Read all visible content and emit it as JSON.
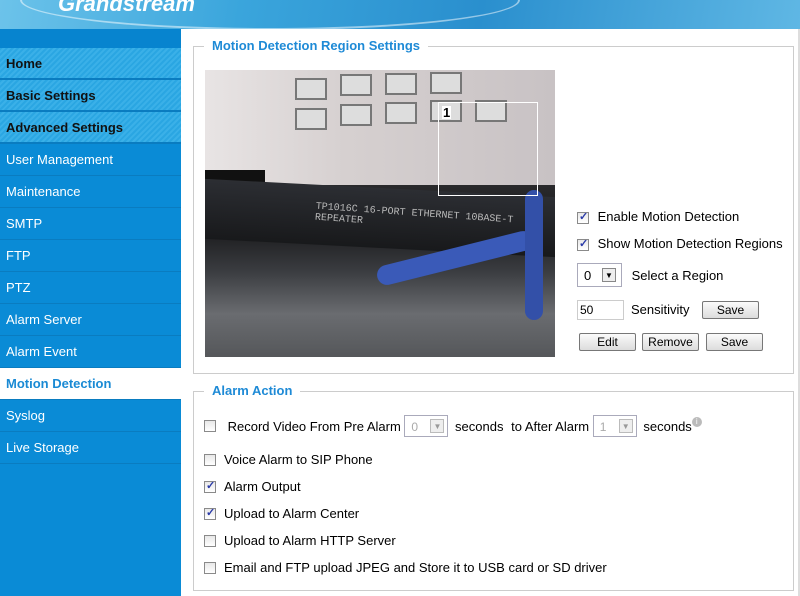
{
  "header": {
    "logo_text": "Grandstream"
  },
  "sidebar": {
    "items": [
      {
        "label": "Home",
        "type": "main"
      },
      {
        "label": "Basic Settings",
        "type": "main"
      },
      {
        "label": "Advanced Settings",
        "type": "main"
      },
      {
        "label": "User Management"
      },
      {
        "label": "Maintenance"
      },
      {
        "label": "SMTP"
      },
      {
        "label": "FTP"
      },
      {
        "label": "PTZ"
      },
      {
        "label": "Alarm Server"
      },
      {
        "label": "Alarm Event"
      },
      {
        "label": "Motion Detection",
        "selected": true
      },
      {
        "label": "Syslog"
      },
      {
        "label": "Live Storage"
      }
    ]
  },
  "region_settings": {
    "title": "Motion Detection Region Settings",
    "region_label": "1",
    "video_overlay_text": "TP1016C 16-PORT ETHERNET 10BASE-T REPEATER",
    "enable_motion_detection": {
      "label": "Enable Motion Detection",
      "checked": true
    },
    "show_regions": {
      "label": "Show Motion Detection Regions",
      "checked": true
    },
    "region_select": {
      "value": "0",
      "label": "Select a Region"
    },
    "sensitivity": {
      "value": "50",
      "label": "Sensitivity",
      "save": "Save"
    },
    "edit": "Edit",
    "remove": "Remove",
    "save": "Save"
  },
  "alarm_action": {
    "title": "Alarm Action",
    "record": {
      "label": "Record Video From Pre Alarm",
      "pre_value": "0",
      "seconds1": "seconds",
      "to_after": "to After Alarm",
      "post_value": "1",
      "seconds2": "seconds",
      "checked": false
    },
    "options": [
      {
        "label": "Voice Alarm to SIP Phone",
        "checked": false
      },
      {
        "label": "Alarm Output",
        "checked": true
      },
      {
        "label": "Upload to Alarm Center",
        "checked": true
      },
      {
        "label": "Upload to Alarm HTTP Server",
        "checked": false
      },
      {
        "label": "Email and FTP upload JPEG and Store it to USB card or SD driver",
        "checked": false
      }
    ]
  }
}
